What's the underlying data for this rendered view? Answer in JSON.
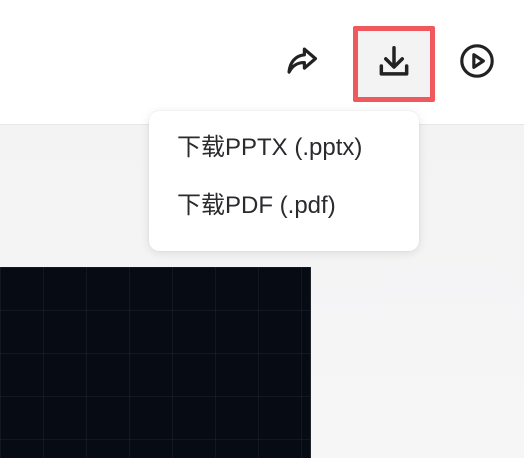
{
  "toolbar": {
    "share_icon": "share-arrow-icon",
    "download_icon": "download-icon",
    "play_icon": "play-circle-icon",
    "highlight_color": "#f0585d"
  },
  "download_menu": {
    "items": [
      {
        "label": "下载PPTX (.pptx)"
      },
      {
        "label": "下载PDF (.pdf)"
      }
    ]
  }
}
